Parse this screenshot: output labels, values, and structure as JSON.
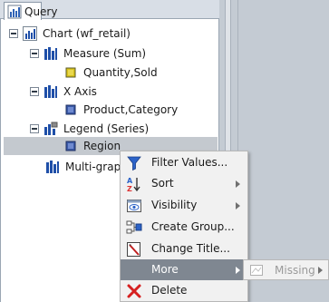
{
  "tab": {
    "label": "Query"
  },
  "tree": {
    "chart": "Chart (wf_retail)",
    "measure": "Measure (Sum)",
    "measure_field": "Quantity,Sold",
    "xaxis": "X Axis",
    "xaxis_field": "Product,Category",
    "legend": "Legend (Series)",
    "legend_field": "Region",
    "multigraph": "Multi-graph"
  },
  "menu": {
    "items": [
      {
        "label": "Filter Values...",
        "icon": "funnel-icon"
      },
      {
        "label": "Sort",
        "icon": "sort-az-icon",
        "submenu": true
      },
      {
        "label": "Visibility",
        "icon": "visibility-icon",
        "submenu": true
      },
      {
        "label": "Create Group...",
        "icon": "group-icon"
      },
      {
        "label": "Change Title...",
        "icon": "edit-title-icon"
      },
      {
        "label": "More",
        "icon": "",
        "submenu": true,
        "highlighted": true
      },
      {
        "label": "Delete",
        "icon": "delete-x-icon"
      }
    ]
  },
  "submenu": {
    "label": "Missing"
  },
  "colors": {
    "menu_highlight": "#7f8791",
    "selected_row": "#c4c9cf",
    "delete_red": "#d62020"
  }
}
